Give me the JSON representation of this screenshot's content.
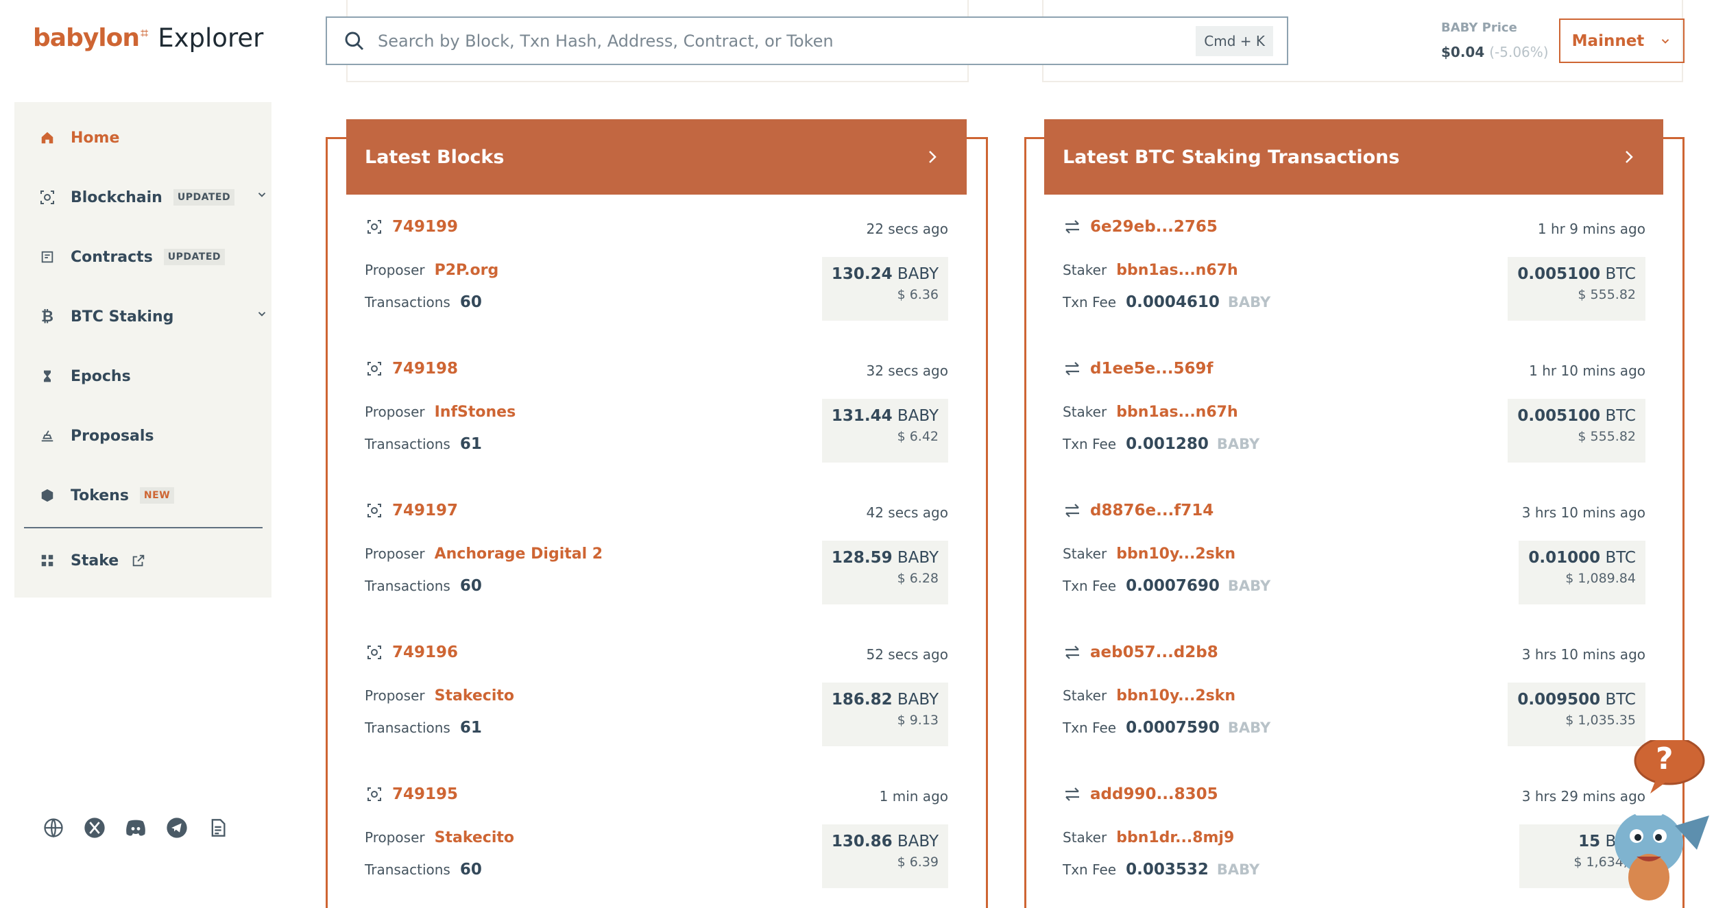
{
  "logo": {
    "brand": "babylon",
    "mark": "⌗",
    "product": "Explorer"
  },
  "sidebar": {
    "items": [
      {
        "label": "Home",
        "icon": "home-icon",
        "active": true
      },
      {
        "label": "Blockchain",
        "icon": "blockchain-icon",
        "badge": "UPDATED",
        "expandable": true
      },
      {
        "label": "Contracts",
        "icon": "contract-icon",
        "badge": "UPDATED"
      },
      {
        "label": "BTC Staking",
        "icon": "bitcoin-icon",
        "expandable": true
      },
      {
        "label": "Epochs",
        "icon": "hourglass-icon"
      },
      {
        "label": "Proposals",
        "icon": "proposal-icon"
      },
      {
        "label": "Tokens",
        "icon": "token-icon",
        "badge": "NEW"
      },
      {
        "label": "Stake",
        "icon": "stake-icon",
        "external": true
      }
    ],
    "social": [
      "globe-icon",
      "x-icon",
      "discord-icon",
      "telegram-icon",
      "docs-icon"
    ]
  },
  "search": {
    "placeholder": "Search by Block, Txn Hash, Address, Contract, or Token",
    "shortcut": "Cmd + K"
  },
  "price": {
    "label": "BABY Price",
    "value": "$0.04",
    "change": "(-5.06%)"
  },
  "network": {
    "label": "Mainnet"
  },
  "colors": {
    "accent": "#ce6533",
    "header_bg": "#c26741",
    "text": "#34495a"
  },
  "blocks": {
    "title": "Latest Blocks",
    "proposer_label": "Proposer",
    "tx_label": "Transactions",
    "unit": "BABY",
    "rows": [
      {
        "height": "749199",
        "time": "22 secs ago",
        "proposer": "P2P.org",
        "txs": "60",
        "amount": "130.24",
        "usd": "$ 6.36"
      },
      {
        "height": "749198",
        "time": "32 secs ago",
        "proposer": "InfStones",
        "txs": "61",
        "amount": "131.44",
        "usd": "$ 6.42"
      },
      {
        "height": "749197",
        "time": "42 secs ago",
        "proposer": "Anchorage Digital 2",
        "txs": "60",
        "amount": "128.59",
        "usd": "$ 6.28"
      },
      {
        "height": "749196",
        "time": "52 secs ago",
        "proposer": "Stakecito",
        "txs": "61",
        "amount": "186.82",
        "usd": "$ 9.13"
      },
      {
        "height": "749195",
        "time": "1 min ago",
        "proposer": "Stakecito",
        "txs": "60",
        "amount": "130.86",
        "usd": "$ 6.39"
      }
    ]
  },
  "staking": {
    "title": "Latest BTC Staking Transactions",
    "staker_label": "Staker",
    "fee_label": "Txn Fee",
    "fee_unit": "BABY",
    "unit": "BTC",
    "rows": [
      {
        "hash": "6e29eb...2765",
        "time": "1 hr 9 mins ago",
        "staker": "bbn1as...n67h",
        "fee": "0.0004610",
        "amount": "0.005100",
        "usd": "$ 555.82"
      },
      {
        "hash": "d1ee5e...569f",
        "time": "1 hr 10 mins ago",
        "staker": "bbn1as...n67h",
        "fee": "0.001280",
        "amount": "0.005100",
        "usd": "$ 555.82"
      },
      {
        "hash": "d8876e...f714",
        "time": "3 hrs 10 mins ago",
        "staker": "bbn10y...2skn",
        "fee": "0.0007690",
        "amount": "0.01000",
        "usd": "$ 1,089.84"
      },
      {
        "hash": "aeb057...d2b8",
        "time": "3 hrs 10 mins ago",
        "staker": "bbn10y...2skn",
        "fee": "0.0007590",
        "amount": "0.009500",
        "usd": "$ 1,035.35"
      },
      {
        "hash": "add990...8305",
        "time": "3 hrs 29 mins ago",
        "staker": "bbn1dr...8mj9",
        "fee": "0.003532",
        "amount": "15",
        "usd": "$ 1,634,7"
      }
    ]
  },
  "help": {
    "label": "?"
  }
}
